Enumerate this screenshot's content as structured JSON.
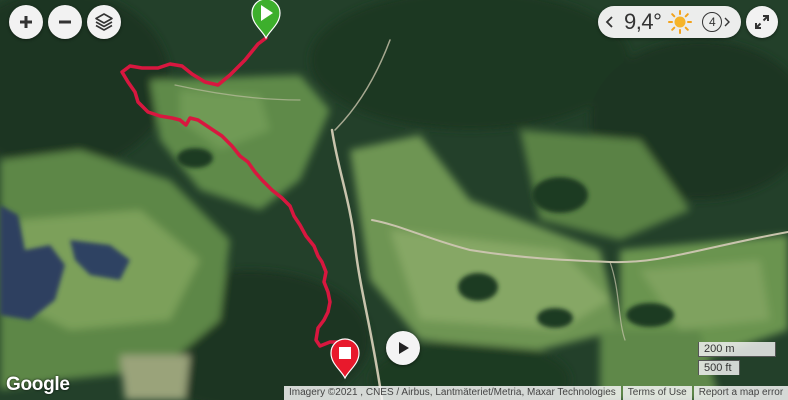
{
  "controls": {
    "zoom_in": "zoom-in",
    "zoom_out": "zoom-out",
    "layers": "layers"
  },
  "weather": {
    "temperature": "9,4°",
    "condition_icon": "sun-icon",
    "uv_index": "4"
  },
  "map": {
    "provider_logo": "Google",
    "attribution": "Imagery ©2021 , CNES / Airbus, Lantmäteriet/Metria, Maxar Technologies",
    "terms": "Terms of Use",
    "report": "Report a map error",
    "scale_metric": "200 m",
    "scale_imperial": "500 ft"
  },
  "route": {
    "color": "#d8173f",
    "start_marker_color": "#3daf2c",
    "end_marker_color": "#e8192c"
  },
  "colors": {
    "forest": "#1f3a22",
    "field": "#7a9a5b",
    "water": "#2b3f5c"
  }
}
